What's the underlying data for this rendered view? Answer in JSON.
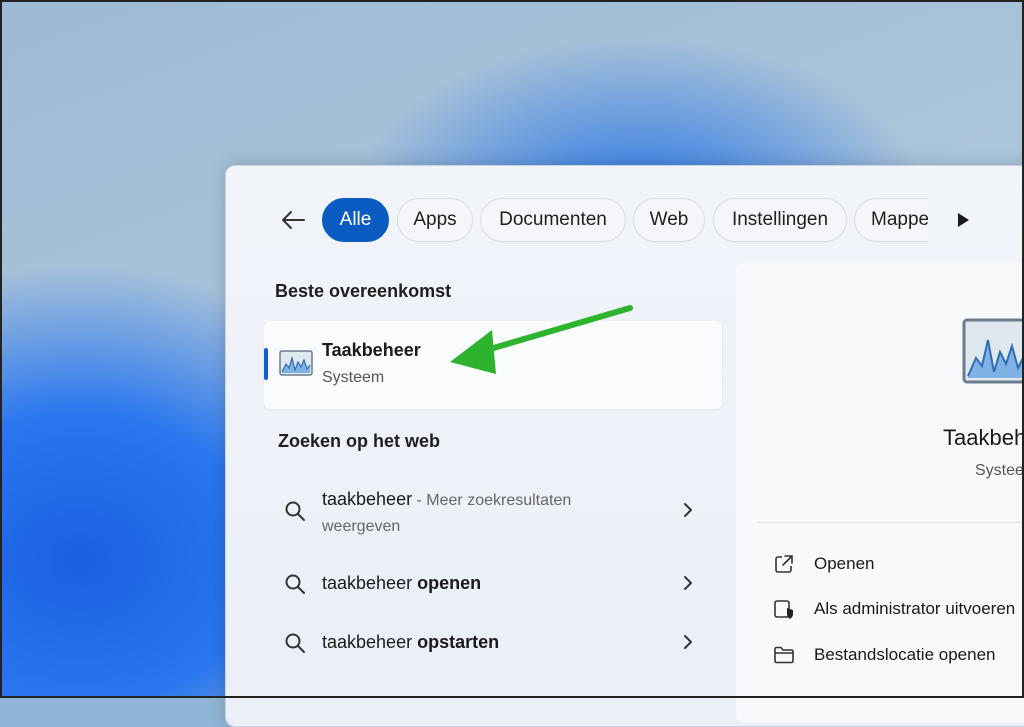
{
  "filters": {
    "back_icon": "back-arrow-icon",
    "tabs": [
      {
        "label": "Alle",
        "active": true
      },
      {
        "label": "Apps",
        "active": false
      },
      {
        "label": "Documenten",
        "active": false
      },
      {
        "label": "Web",
        "active": false
      },
      {
        "label": "Instellingen",
        "active": false
      },
      {
        "label": "Mappe",
        "active": false
      }
    ],
    "more_icon": "play-triangle-icon"
  },
  "best_match": {
    "section_title": "Beste overeenkomst",
    "app_name": "Taakbeheer",
    "app_type": "Systeem",
    "icon": "task-manager-icon"
  },
  "web": {
    "section_title": "Zoeken op het web",
    "results": [
      {
        "query": "taakbeheer",
        "suffix_plain": " - Meer zoekresultaten",
        "line2": "weergeven"
      },
      {
        "query": "taakbeheer ",
        "suffix_bold": "openen"
      },
      {
        "query": "taakbeheer ",
        "suffix_bold": "opstarten"
      }
    ]
  },
  "detail": {
    "title": "Taakbehe",
    "subtitle": "Systee",
    "actions": [
      {
        "label": "Openen",
        "icon": "open-external-icon"
      },
      {
        "label": "Als administrator uitvoeren",
        "icon": "shield-run-icon"
      },
      {
        "label": "Bestandslocatie openen",
        "icon": "folder-icon"
      }
    ]
  },
  "annotation": {
    "color": "#2db32d"
  },
  "colors": {
    "accent": "#0a5bc2"
  }
}
